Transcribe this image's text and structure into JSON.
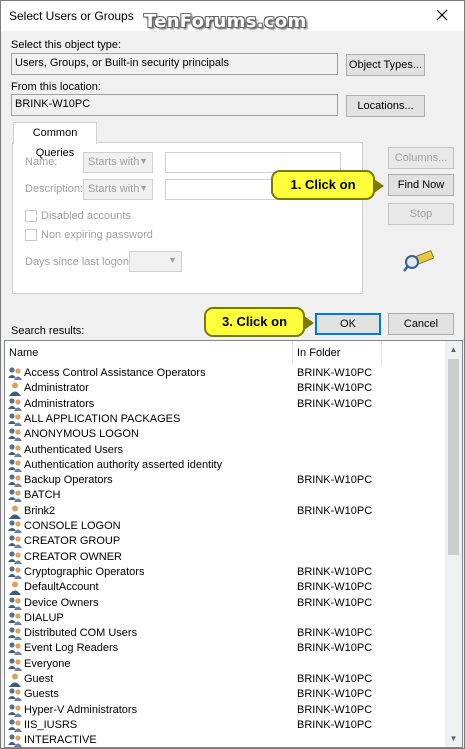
{
  "window": {
    "title": "Select Users or Groups",
    "watermark": "TenForums.com"
  },
  "object_type": {
    "label": "Select this object type:",
    "value": "Users, Groups, or Built-in security principals",
    "button": "Object Types..."
  },
  "location": {
    "label": "From this location:",
    "value": "BRINK-W10PC",
    "button": "Locations..."
  },
  "common_queries": {
    "tab": "Common Queries",
    "name_label": "Name:",
    "name_mode": "Starts with",
    "description_label": "Description:",
    "description_mode": "Starts with",
    "disabled_accounts": "Disabled accounts",
    "non_expiring_password": "Non expiring password",
    "days_label": "Days since last logon:"
  },
  "side_buttons": {
    "columns": "Columns...",
    "find_now": "Find Now",
    "stop": "Stop"
  },
  "callouts": {
    "find_now": "1. Click on",
    "ok": "3. Click on"
  },
  "footer": {
    "search_results_label": "Search results:",
    "ok": "OK",
    "cancel": "Cancel"
  },
  "results": {
    "columns": [
      "Name",
      "In Folder"
    ],
    "rows": [
      {
        "name": "Access Control Assistance Operators",
        "folder": "BRINK-W10PC",
        "icon": "group-icon"
      },
      {
        "name": "Administrator",
        "folder": "BRINK-W10PC",
        "icon": "user-icon"
      },
      {
        "name": "Administrators",
        "folder": "BRINK-W10PC",
        "icon": "group-icon"
      },
      {
        "name": "ALL APPLICATION PACKAGES",
        "folder": "",
        "icon": "group-icon"
      },
      {
        "name": "ANONYMOUS LOGON",
        "folder": "",
        "icon": "group-icon"
      },
      {
        "name": "Authenticated Users",
        "folder": "",
        "icon": "group-icon"
      },
      {
        "name": "Authentication authority asserted identity",
        "folder": "",
        "icon": "group-icon"
      },
      {
        "name": "Backup Operators",
        "folder": "BRINK-W10PC",
        "icon": "group-icon"
      },
      {
        "name": "BATCH",
        "folder": "",
        "icon": "group-icon"
      },
      {
        "name": "Brink2",
        "folder": "BRINK-W10PC",
        "icon": "user-icon"
      },
      {
        "name": "CONSOLE LOGON",
        "folder": "",
        "icon": "group-icon"
      },
      {
        "name": "CREATOR GROUP",
        "folder": "",
        "icon": "group-icon"
      },
      {
        "name": "CREATOR OWNER",
        "folder": "",
        "icon": "group-icon"
      },
      {
        "name": "Cryptographic Operators",
        "folder": "BRINK-W10PC",
        "icon": "group-icon"
      },
      {
        "name": "DefaultAccount",
        "folder": "BRINK-W10PC",
        "icon": "user-icon"
      },
      {
        "name": "Device Owners",
        "folder": "BRINK-W10PC",
        "icon": "group-icon"
      },
      {
        "name": "DIALUP",
        "folder": "",
        "icon": "group-icon"
      },
      {
        "name": "Distributed COM Users",
        "folder": "BRINK-W10PC",
        "icon": "group-icon"
      },
      {
        "name": "Event Log Readers",
        "folder": "BRINK-W10PC",
        "icon": "group-icon"
      },
      {
        "name": "Everyone",
        "folder": "",
        "icon": "group-icon"
      },
      {
        "name": "Guest",
        "folder": "BRINK-W10PC",
        "icon": "user-icon"
      },
      {
        "name": "Guests",
        "folder": "BRINK-W10PC",
        "icon": "group-icon"
      },
      {
        "name": "Hyper-V Administrators",
        "folder": "BRINK-W10PC",
        "icon": "group-icon"
      },
      {
        "name": "IIS_IUSRS",
        "folder": "BRINK-W10PC",
        "icon": "group-icon"
      },
      {
        "name": "INTERACTIVE",
        "folder": "",
        "icon": "group-icon"
      }
    ]
  },
  "colors": {
    "accent": "#0078d7",
    "callout": "#ffff3c",
    "disabled": "#a0a0a0"
  }
}
